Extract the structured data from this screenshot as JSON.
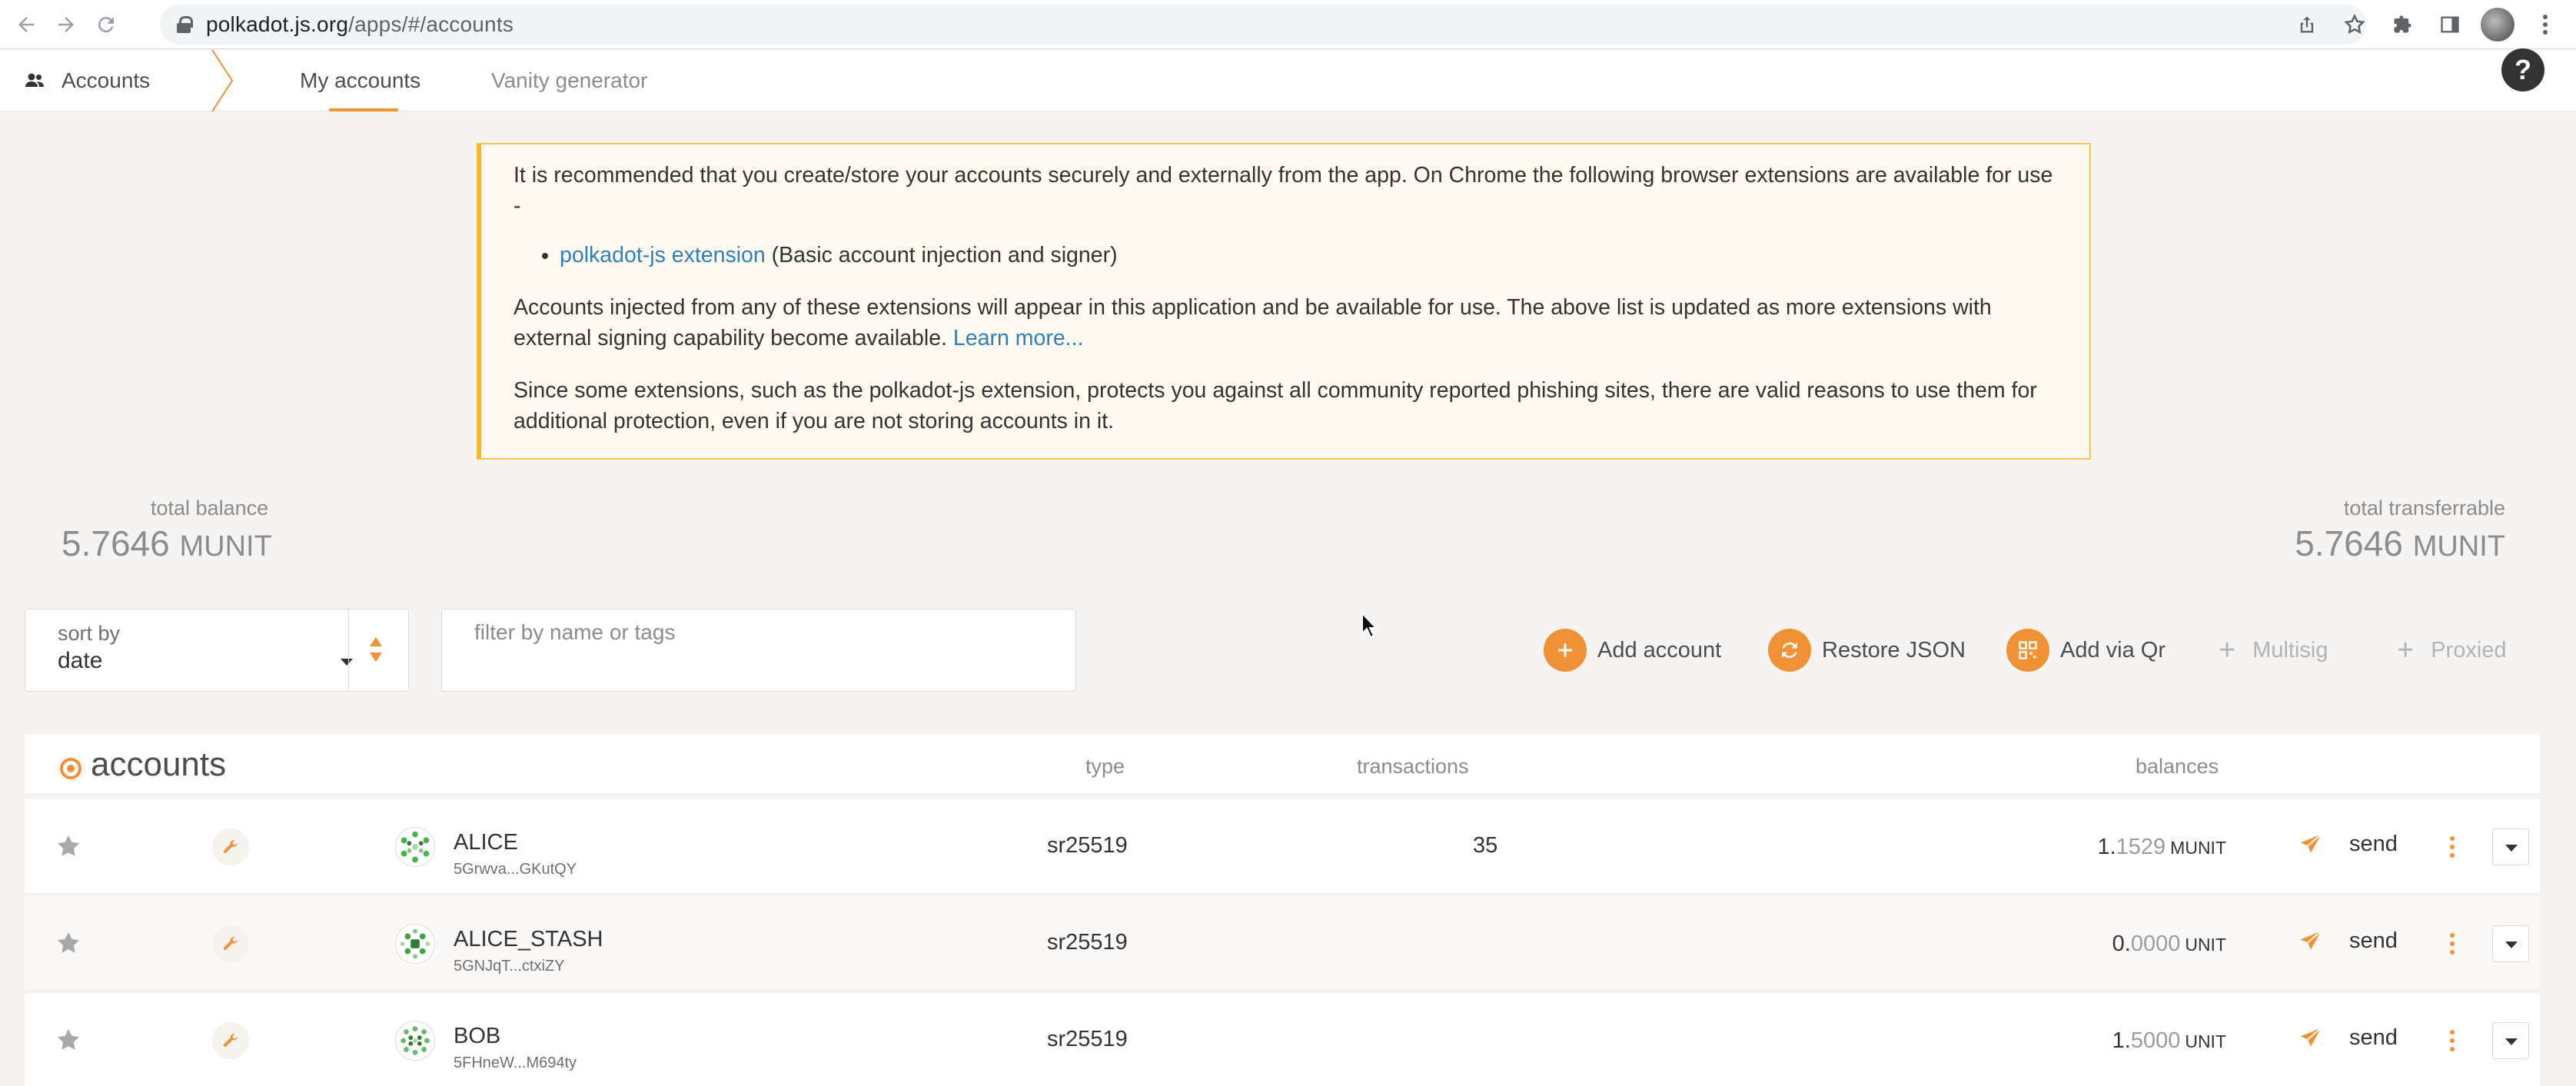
{
  "browser": {
    "url_host": "polkadot.js.org",
    "url_path": "/apps/#/accounts"
  },
  "appbar": {
    "section_label": "Accounts",
    "tabs": [
      {
        "label": "My accounts",
        "active": true
      },
      {
        "label": "Vanity generator",
        "active": false
      }
    ],
    "help_label": "?"
  },
  "notice": {
    "p1": "It is recommended that you create/store your accounts securely and externally from the app. On Chrome the following browser extensions are available for use -",
    "ext_link": "polkadot-js extension",
    "ext_desc": " (Basic account injection and signer)",
    "p2": "Accounts injected from any of these extensions will appear in this application and be available for use. The above list is updated as more extensions with external signing capability become available. ",
    "learn_more": "Learn more...",
    "p3": "Since some extensions, such as the polkadot-js extension, protects you against all community reported phishing sites, there are valid reasons to use them for additional protection, even if you are not storing accounts in it."
  },
  "summary": {
    "total_balance_label": "total balance",
    "total_balance_value": "5.7646",
    "total_balance_unit": "MUNIT",
    "total_transferrable_label": "total transferrable",
    "total_transferrable_value": "5.7646",
    "total_transferrable_unit": "MUNIT"
  },
  "filters": {
    "sort_label": "sort by",
    "sort_value": "date",
    "filter_placeholder": "filter by name or tags"
  },
  "actions": {
    "add_account": "Add account",
    "restore_json": "Restore JSON",
    "add_via_qr": "Add via Qr",
    "multisig": "Multisig",
    "proxied": "Proxied"
  },
  "table": {
    "title": "accounts",
    "headers": {
      "type": "type",
      "transactions": "transactions",
      "balances": "balances"
    },
    "rows": [
      {
        "name": "ALICE",
        "address": "5Grwva...GKutQY",
        "type": "sr25519",
        "transactions": "35",
        "balance_int": "1.",
        "balance_dec": "1529",
        "unit": "MUNIT",
        "send": "send"
      },
      {
        "name": "ALICE_STASH",
        "address": "5GNJqT...ctxiZY",
        "type": "sr25519",
        "transactions": "",
        "balance_int": "0.",
        "balance_dec": "0000",
        "unit": "UNIT",
        "send": "send"
      },
      {
        "name": "BOB",
        "address": "5FHneW...M694ty",
        "type": "sr25519",
        "transactions": "",
        "balance_int": "1.",
        "balance_dec": "5000",
        "unit": "UNIT",
        "send": "send"
      }
    ]
  },
  "colors": {
    "accent": "#f19135",
    "notice_border": "#f5b728",
    "link": "#2f7fbd"
  },
  "icons": [
    "back-arrow-icon",
    "forward-arrow-icon",
    "reload-icon",
    "lock-icon",
    "share-icon",
    "bookmark-star-icon",
    "extensions-icon",
    "side-panel-icon",
    "users-icon",
    "help-icon",
    "plus-icon",
    "restore-icon",
    "qr-icon",
    "star-icon",
    "wrench-icon",
    "paper-plane-icon",
    "kebab-menu-icon",
    "chevron-down-icon"
  ]
}
